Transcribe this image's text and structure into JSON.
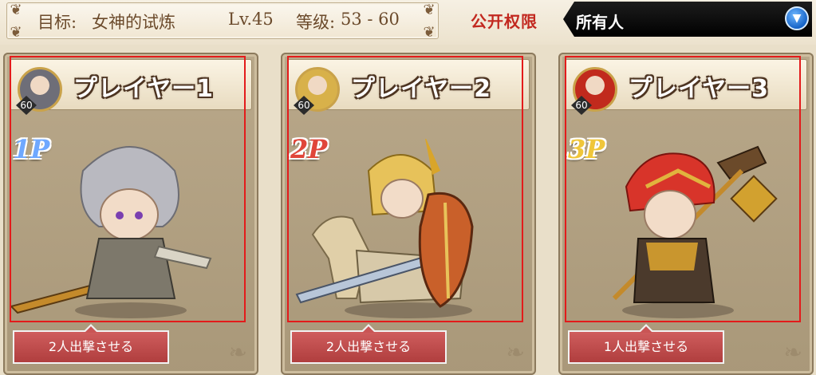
{
  "header": {
    "quest_label": "目标:",
    "quest_name": "女神的试炼",
    "level": "Lv.45",
    "grade_label": "等级:",
    "grade_range": "53 - 60",
    "permission_label": "公开权限",
    "permission_value": "所有人"
  },
  "players": [
    {
      "name": "プレイヤー1",
      "badge": "1P",
      "level": "60",
      "sortie_label": "2人出撃させる",
      "badge_color": "#6fa8ff"
    },
    {
      "name": "プレイヤー2",
      "badge": "2P",
      "level": "60",
      "sortie_label": "2人出撃させる",
      "badge_color": "#e0463a"
    },
    {
      "name": "プレイヤー3",
      "badge": "3P",
      "level": "60",
      "sortie_label": "1人出撃させる",
      "badge_color": "#f0c63a"
    }
  ],
  "icons": {
    "dropdown": "chevron-down-icon",
    "corner": "ornament-icon"
  },
  "colors": {
    "highlight": "#e31b1b",
    "permission": "#c2281f",
    "sortie_button": "#b94848"
  }
}
